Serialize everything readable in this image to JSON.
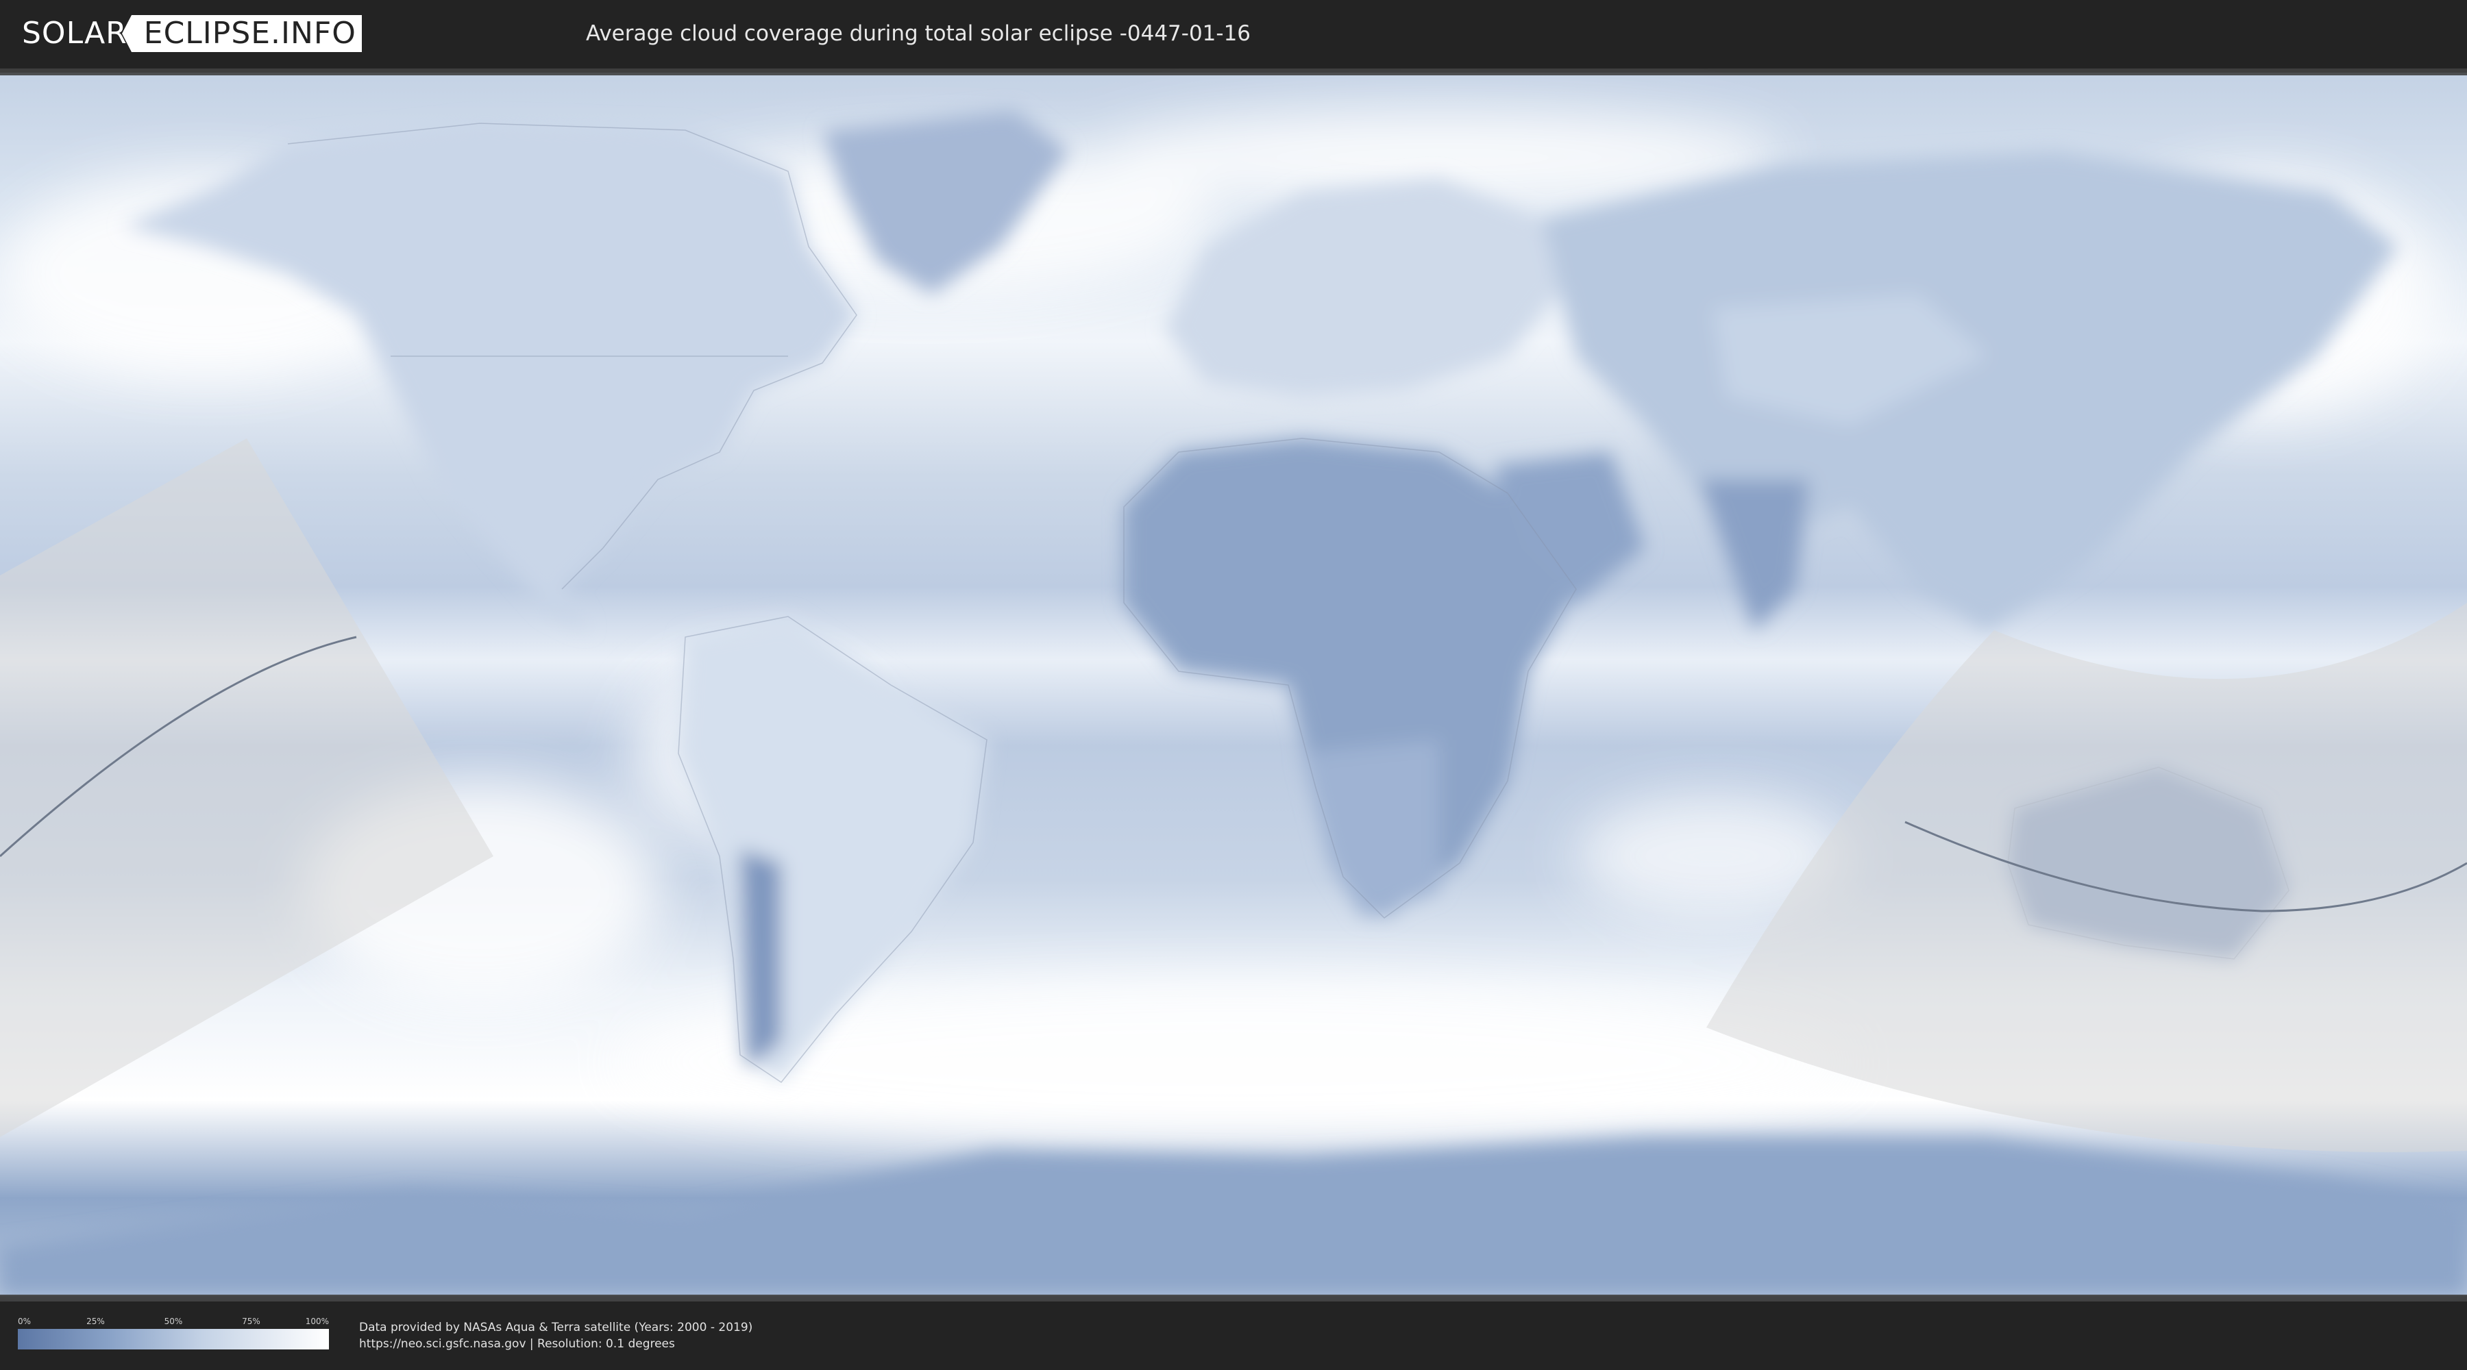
{
  "header": {
    "logo_left": "SOLAR",
    "logo_right": "ECLIPSE.INFO",
    "title": "Average cloud coverage during total solar eclipse -0447-01-16"
  },
  "legend": {
    "ticks": [
      "0%",
      "25%",
      "50%",
      "75%",
      "100%"
    ],
    "gradient_colors": [
      "#5c77a5",
      "#8aa3c8",
      "#c5d3e6",
      "#ffffff"
    ]
  },
  "footer": {
    "credit_line1": "Data provided by NASAs Aqua & Terra satellite (Years: 2000 - 2019)",
    "credit_line2": "https://neo.sci.gsfc.nasa.gov | Resolution: 0.1 degrees"
  },
  "map": {
    "projection": "equirectangular",
    "ocean_cloud_color": "#b7c8df",
    "clear_sky_color": "#6f87b1",
    "full_cloud_color": "#ffffff",
    "eclipse_zone_color": "#d6d6d6"
  }
}
